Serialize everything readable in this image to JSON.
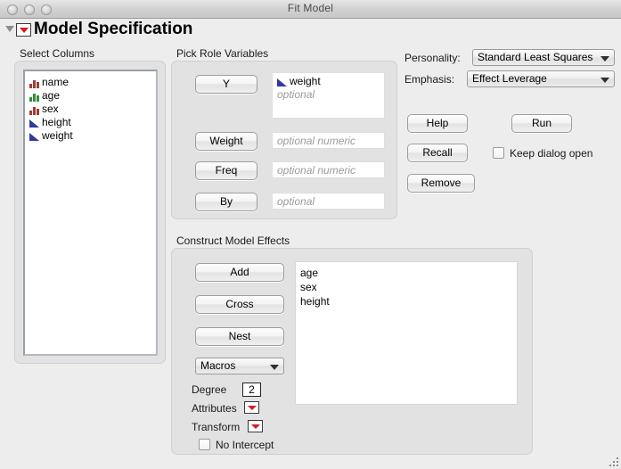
{
  "window": {
    "title": "Fit Model",
    "traffic_lights": [
      "close-button",
      "minimize-button",
      "zoom-button"
    ]
  },
  "header": {
    "title": "Model Specification",
    "disclosure_icon": "disclosure-triangle-down-icon",
    "red_menu_icon": "red-triangle-menu-icon"
  },
  "select_columns": {
    "caption": "Select Columns",
    "items": [
      {
        "label": "name",
        "type": "nominal"
      },
      {
        "label": "age",
        "type": "ordinal"
      },
      {
        "label": "sex",
        "type": "nominal"
      },
      {
        "label": "height",
        "type": "continuous"
      },
      {
        "label": "weight",
        "type": "continuous"
      }
    ]
  },
  "pick_role_variables": {
    "caption": "Pick Role Variables",
    "roles": [
      {
        "button": "Y",
        "values": [
          {
            "label": "weight",
            "type": "continuous"
          }
        ],
        "placeholder": "optional"
      },
      {
        "button": "Weight",
        "values": [],
        "placeholder": "optional numeric"
      },
      {
        "button": "Freq",
        "values": [],
        "placeholder": "optional numeric"
      },
      {
        "button": "By",
        "values": [],
        "placeholder": "optional"
      }
    ]
  },
  "options": {
    "personality_label": "Personality:",
    "personality_value": "Standard Least Squares",
    "emphasis_label": "Emphasis:",
    "emphasis_value": "Effect Leverage",
    "help_label": "Help",
    "run_label": "Run",
    "recall_label": "Recall",
    "remove_label": "Remove",
    "keep_dialog_open_label": "Keep dialog open",
    "keep_dialog_open_checked": false
  },
  "construct_model_effects": {
    "caption": "Construct Model Effects",
    "add_label": "Add",
    "cross_label": "Cross",
    "nest_label": "Nest",
    "macros_label": "Macros",
    "effects": [
      "age",
      "sex",
      "height"
    ],
    "degree_label": "Degree",
    "degree_value": "2",
    "attributes_label": "Attributes",
    "transform_label": "Transform",
    "no_intercept_label": "No Intercept",
    "no_intercept_checked": false
  },
  "colors": {
    "nominal_icon": "#a33a35",
    "ordinal_icon": "#2f8f3c",
    "continuous_icon": "#2f3a9e",
    "red_menu": "#d81c1c",
    "dialog_bg": "#ededed",
    "panel_bg": "#e2e2e2"
  }
}
